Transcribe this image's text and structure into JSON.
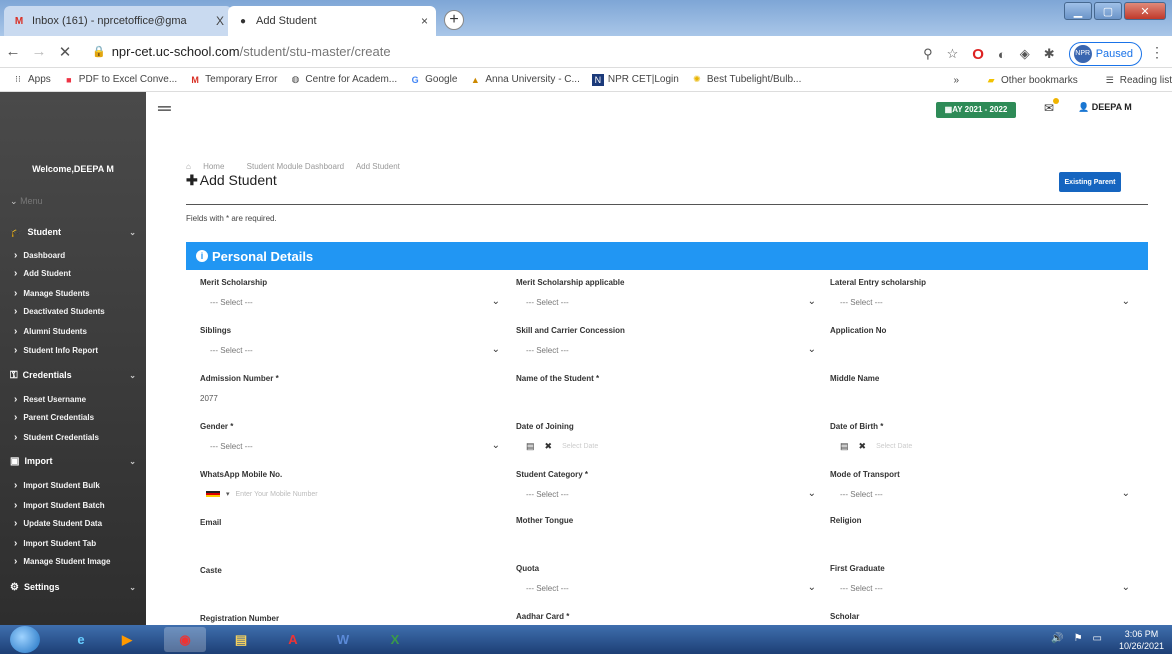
{
  "browser": {
    "tabs": [
      {
        "label": "Inbox (161) - nprcetoffice@gma",
        "close": "X"
      },
      {
        "label": "Add Student",
        "close": "×"
      }
    ],
    "new_tab": "+",
    "url_domain": "npr-cet.uc-school.com",
    "url_path": "/student/stu-master/create",
    "profile_status": "Paused",
    "bookmarks": [
      "Apps",
      "PDF to Excel Conve...",
      "Temporary Error",
      "Centre for Academ...",
      "Google",
      "Anna University - C...",
      "NPR CET|Login",
      "Best Tubelight/Bulb..."
    ],
    "bookmarks_more": "»",
    "other_bookmarks": "Other bookmarks",
    "reading_list": "Reading list"
  },
  "sidebar": {
    "welcome": "Welcome,DEEPA M",
    "menu_toggle": "Menu",
    "sections": [
      {
        "label": "Student",
        "items": [
          "Dashboard",
          "Add Student",
          "Manage Students",
          "Deactivated Students",
          "Alumni Students",
          "Student Info Report"
        ]
      },
      {
        "label": "Credentials",
        "items": [
          "Reset Username",
          "Parent Credentials",
          "Student Credentials"
        ]
      },
      {
        "label": "Import",
        "items": [
          "Import Student Bulk",
          "Import Student Batch",
          "Update Student Data",
          "Import Student Tab",
          "Manage Student Image"
        ]
      },
      {
        "label": "Settings",
        "items": []
      }
    ]
  },
  "topbar": {
    "academic_year": "AY 2021 - 2022",
    "user_name": "DEEPA M"
  },
  "breadcrumb": [
    "Home",
    "Student Module Dashboard",
    "Add Student"
  ],
  "page_title": "Add Student",
  "existing_parent_button": "Existing Parent",
  "required_note": "Fields with * are required.",
  "personal_details": {
    "header": "Personal Details",
    "fields": [
      {
        "label": "Merit Scholarship",
        "value": "--- Select ---"
      },
      {
        "label": "Merit Scholarship applicable",
        "value": "--- Select ---"
      },
      {
        "label": "Lateral Entry scholarship",
        "value": "--- Select ---"
      },
      {
        "label": "Siblings",
        "value": "--- Select ---"
      },
      {
        "label": "Skill and Carrier Concession",
        "value": "--- Select ---"
      },
      {
        "label": "Application No",
        "value": ""
      },
      {
        "label": "Admission Number *",
        "value": "2077"
      },
      {
        "label": "Name of the Student *",
        "value": ""
      },
      {
        "label": "Middle Name",
        "value": ""
      },
      {
        "label": "Gender *",
        "value": "--- Select ---"
      },
      {
        "label": "Date of Joining",
        "value": "Select Date"
      },
      {
        "label": "Date of Birth *",
        "value": "Select Date"
      },
      {
        "label": "WhatsApp Mobile No.",
        "value": "Enter Your Mobile Number"
      },
      {
        "label": "Student Category *",
        "value": "--- Select ---"
      },
      {
        "label": "Mode of Transport",
        "value": "--- Select ---"
      },
      {
        "label": "Email",
        "value": ""
      },
      {
        "label": "Mother Tongue",
        "value": ""
      },
      {
        "label": "Religion",
        "value": ""
      },
      {
        "label": "Caste",
        "value": ""
      },
      {
        "label": "Quota",
        "value": "--- Select ---"
      },
      {
        "label": "First Graduate",
        "value": "--- Select ---"
      },
      {
        "label": "Registration Number",
        "value": ""
      },
      {
        "label": "Aadhar Card *",
        "value": ""
      },
      {
        "label": "Scholar",
        "value": ""
      }
    ]
  },
  "taskbar": {
    "time": "3:06 PM",
    "date": "10/26/2021"
  },
  "colors": {
    "section_header": "#2196f3",
    "sidebar_bg": "#3a3a3a",
    "ay_badge": "#2e8b57",
    "primary_button": "#1565c0"
  }
}
